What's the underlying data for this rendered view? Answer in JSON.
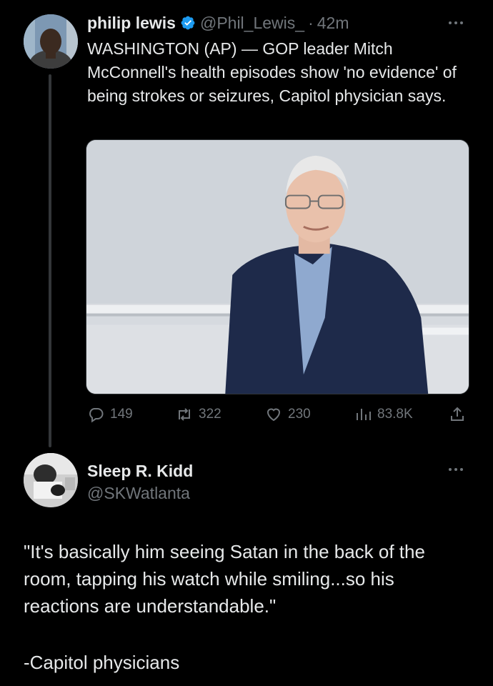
{
  "tweet": {
    "author_name": "philip lewis",
    "verified": true,
    "handle": "@Phil_Lewis_",
    "separator": "·",
    "time": "42m",
    "text": "WASHINGTON (AP) — GOP leader Mitch McConnell's health episodes show 'no evidence' of being strokes or seizures, Capitol physician says.",
    "media_icon": "photo",
    "stats": {
      "replies": "149",
      "reposts": "322",
      "likes": "230",
      "views": "83.8K"
    },
    "icons": {
      "reply": "reply-icon",
      "repost": "repost-icon",
      "like": "heart-icon",
      "views": "views-icon",
      "share": "share-icon",
      "more": "more-icon",
      "verified": "verified-badge-icon"
    }
  },
  "reply": {
    "author_name": "Sleep R. Kidd",
    "handle": "@SKWatlanta",
    "text": "\"It's basically him seeing Satan in the back of the room, tapping his watch while smiling...so his reactions are understandable.\"",
    "signature": "-Capitol physicians"
  },
  "colors": {
    "background": "#000000",
    "text": "#e7e9ea",
    "secondary": "#71767b",
    "verified": "#1d9bf0",
    "thread_line": "#333639"
  }
}
